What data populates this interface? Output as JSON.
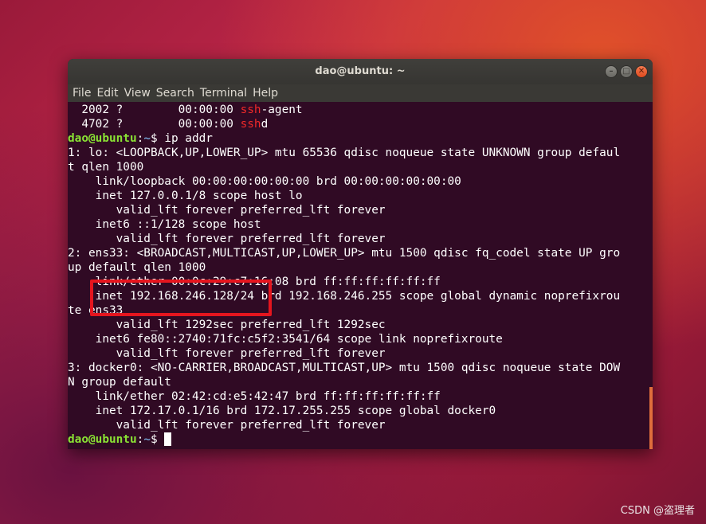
{
  "window": {
    "title": "dao@ubuntu: ~"
  },
  "window_buttons": {
    "minimize": "–",
    "maximize": "□",
    "close": "✕"
  },
  "menu": [
    "File",
    "Edit",
    "View",
    "Search",
    "Terminal",
    "Help"
  ],
  "terminal": {
    "ps_lines": [
      {
        "pid": "  2002 ?        00:00:00 ",
        "cmd_hl": "ssh",
        "cmd_rest": "-agent"
      },
      {
        "pid": "  4702 ?        00:00:00 ",
        "cmd_hl": "ssh",
        "cmd_rest": "d"
      }
    ],
    "prompt_user": "dao@ubuntu",
    "prompt_sep": ":",
    "prompt_path": "~",
    "prompt_end": "$ ",
    "command": "ip addr",
    "output_lines": [
      "1: lo: <LOOPBACK,UP,LOWER_UP> mtu 65536 qdisc noqueue state UNKNOWN group defaul",
      "t qlen 1000",
      "    link/loopback 00:00:00:00:00:00 brd 00:00:00:00:00:00",
      "    inet 127.0.0.1/8 scope host lo",
      "       valid_lft forever preferred_lft forever",
      "    inet6 ::1/128 scope host",
      "       valid_lft forever preferred_lft forever",
      "2: ens33: <BROADCAST,MULTICAST,UP,LOWER_UP> mtu 1500 qdisc fq_codel state UP gro",
      "up default qlen 1000",
      "    link/ether 00:0c:29:c7:16:08 brd ff:ff:ff:ff:ff:ff",
      "    inet 192.168.246.128/24 brd 192.168.246.255 scope global dynamic noprefixrou",
      "te ens33",
      "       valid_lft 1292sec preferred_lft 1292sec",
      "    inet6 fe80::2740:71fc:c5f2:3541/64 scope link noprefixroute",
      "       valid_lft forever preferred_lft forever",
      "3: docker0: <NO-CARRIER,BROADCAST,MULTICAST,UP> mtu 1500 qdisc noqueue state DOW",
      "N group default",
      "    link/ether 02:42:cd:e5:42:47 brd ff:ff:ff:ff:ff:ff",
      "    inet 172.17.0.1/16 brd 172.17.255.255 scope global docker0",
      "       valid_lft forever preferred_lft forever"
    ]
  },
  "watermark": "CSDN @盗理者",
  "colors": {
    "accent_red": "#e5151e",
    "prompt_green": "#8ae234",
    "path_blue": "#729fcf",
    "terminal_bg": "#300a24"
  }
}
